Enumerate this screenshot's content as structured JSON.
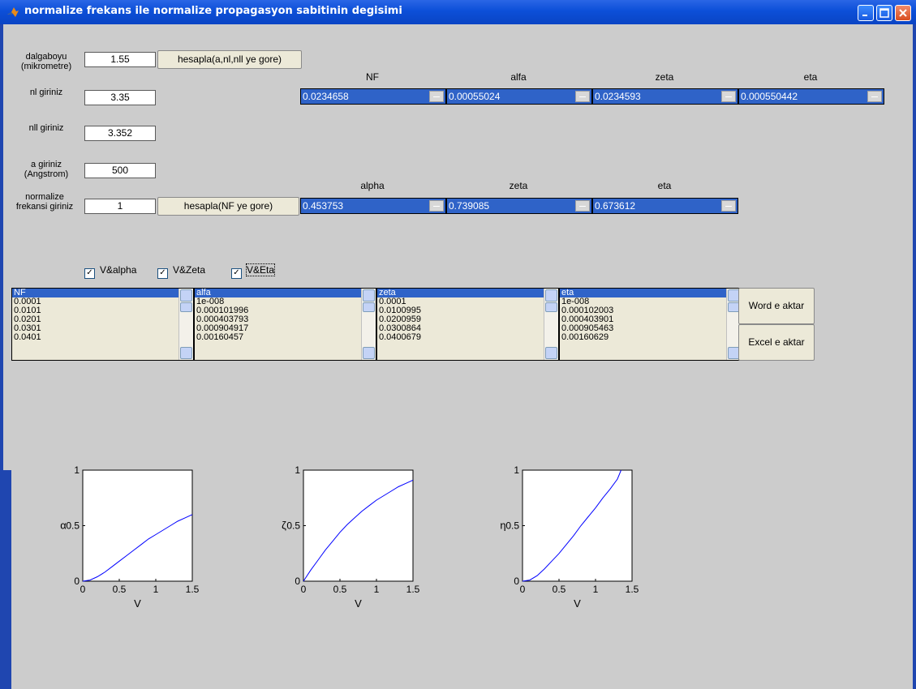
{
  "window": {
    "title": "normalize frekans ile normalize propagasyon sabitinin degisimi"
  },
  "inputs": {
    "wavelength": {
      "label_line1": "dalgaboyu",
      "label_line2": "(mikrometre)",
      "value": "1.55"
    },
    "n1": {
      "label": "nl giriniz",
      "value": "3.35"
    },
    "n2": {
      "label": "nll giriniz",
      "value": "3.352"
    },
    "a": {
      "label_line1": "a giriniz",
      "label_line2": "(Angstrom)",
      "value": "500"
    },
    "nf": {
      "label_line1": "normalize",
      "label_line2": "frekansi giriniz",
      "value": "1"
    }
  },
  "buttons": {
    "calc_by_params": "hesapla(a,nl,nll ye gore)",
    "calc_by_nf": "hesapla(NF ye gore)",
    "export_word": "Word e aktar",
    "export_excel": "Excel e aktar"
  },
  "results_row1": {
    "headers": [
      "NF",
      "alfa",
      "zeta",
      "eta"
    ],
    "values": [
      "0.0234658",
      "0.00055024",
      "0.0234593",
      "0.000550442"
    ]
  },
  "results_row2": {
    "headers": [
      "alpha",
      "zeta",
      "eta"
    ],
    "values": [
      "0.453753",
      "0.739085",
      "0.673612"
    ]
  },
  "checkboxes": [
    {
      "label": "V&alpha",
      "checked": true
    },
    {
      "label": "V&Zeta",
      "checked": true
    },
    {
      "label": "V&Eta",
      "checked": true
    }
  ],
  "lists": [
    {
      "items": [
        "NF",
        "0.0001",
        "0.0101",
        "0.0201",
        "0.0301",
        "0.0401"
      ]
    },
    {
      "items": [
        "alfa",
        "1e-008",
        "0.000101996",
        "0.000403793",
        "0.000904917",
        "0.00160457"
      ]
    },
    {
      "items": [
        "zeta",
        "0.0001",
        "0.0100995",
        "0.0200959",
        "0.0300864",
        "0.0400679"
      ]
    },
    {
      "items": [
        "eta",
        "1e-008",
        "0.000102003",
        "0.000403901",
        "0.000905463",
        "0.00160629"
      ]
    }
  ],
  "chart_data": [
    {
      "type": "line",
      "xlabel": "V",
      "ylabel": "α",
      "xlim": [
        0,
        1.5
      ],
      "ylim": [
        0,
        1
      ],
      "xticks": [
        "0",
        "0.5",
        "1",
        "1.5"
      ],
      "yticks": [
        "0",
        "0.5",
        "1"
      ],
      "x": [
        0,
        0.1,
        0.2,
        0.3,
        0.4,
        0.5,
        0.6,
        0.7,
        0.8,
        0.9,
        1.0,
        1.1,
        1.2,
        1.3,
        1.4,
        1.5
      ],
      "y": [
        0,
        0.01,
        0.04,
        0.08,
        0.13,
        0.18,
        0.23,
        0.28,
        0.33,
        0.38,
        0.42,
        0.46,
        0.5,
        0.54,
        0.57,
        0.6
      ],
      "color": "#0000ff"
    },
    {
      "type": "line",
      "xlabel": "V",
      "ylabel": "ζ",
      "xlim": [
        0,
        1.5
      ],
      "ylim": [
        0,
        1
      ],
      "xticks": [
        "0",
        "0.5",
        "1",
        "1.5"
      ],
      "yticks": [
        "0",
        "0.5",
        "1"
      ],
      "x": [
        0,
        0.1,
        0.2,
        0.3,
        0.4,
        0.5,
        0.6,
        0.7,
        0.8,
        0.9,
        1.0,
        1.1,
        1.2,
        1.3,
        1.4,
        1.5
      ],
      "y": [
        0,
        0.1,
        0.19,
        0.28,
        0.36,
        0.44,
        0.51,
        0.57,
        0.63,
        0.68,
        0.73,
        0.77,
        0.81,
        0.85,
        0.88,
        0.91
      ],
      "color": "#0000ff"
    },
    {
      "type": "line",
      "xlabel": "V",
      "ylabel": "η",
      "xlim": [
        0,
        1.5
      ],
      "ylim": [
        0,
        1
      ],
      "xticks": [
        "0",
        "0.5",
        "1",
        "1.5"
      ],
      "yticks": [
        "0",
        "0.5",
        "1"
      ],
      "x": [
        0,
        0.1,
        0.2,
        0.3,
        0.4,
        0.5,
        0.6,
        0.7,
        0.8,
        0.9,
        1.0,
        1.1,
        1.2,
        1.3,
        1.35
      ],
      "y": [
        0,
        0.01,
        0.05,
        0.11,
        0.18,
        0.25,
        0.33,
        0.41,
        0.5,
        0.58,
        0.66,
        0.75,
        0.83,
        0.92,
        1.0
      ],
      "color": "#0000ff"
    }
  ]
}
